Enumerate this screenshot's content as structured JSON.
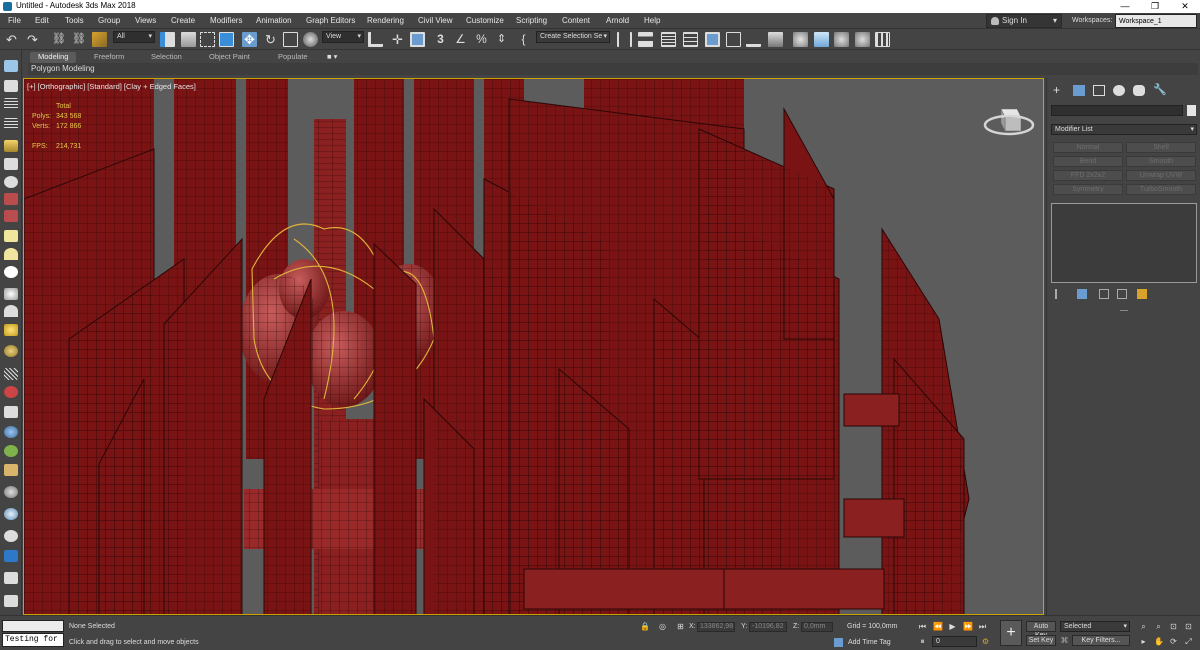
{
  "window": {
    "title": "Untitled - Autodesk 3ds Max 2018",
    "minimize_glyph": "—",
    "maximize_glyph": "❐",
    "close_glyph": "✕"
  },
  "menu": {
    "items": [
      "File",
      "Edit",
      "Tools",
      "Group",
      "Views",
      "Create",
      "Modifiers",
      "Animation",
      "Graph Editors",
      "Rendering",
      "Civil View",
      "Customize",
      "Scripting",
      "Content",
      "Arnold",
      "Help"
    ],
    "sign_in": "Sign In",
    "workspaces_label": "Workspaces:",
    "workspace_value": "Workspace_1"
  },
  "toolbar": {
    "selection_filter": "All",
    "reference_coord": "View",
    "named_selection": "Create Selection Se"
  },
  "ribbon": {
    "tabs": [
      "Modeling",
      "Freeform",
      "Selection",
      "Object Paint",
      "Populate"
    ],
    "active_tab": "Modeling",
    "sub_label": "Polygon Modeling"
  },
  "viewport": {
    "label": "[+] [Orthographic] [Standard] [Clay + Edged Faces]",
    "stats": {
      "total_label": "Total",
      "polys_label": "Polys:",
      "polys_value": "343 568",
      "verts_label": "Verts:",
      "verts_value": "172 866",
      "fps_label": "FPS:",
      "fps_value": "214,731"
    },
    "model_color": "#7a1414",
    "background_color": "#5c5c5c",
    "spline_color": "#e0b43a"
  },
  "command_panel": {
    "modifier_list": "Modifier List",
    "modifier_buttons": [
      "Normal",
      "Shell",
      "Bend",
      "Smooth",
      "FFD 2x2x2",
      "Unwrap UVW",
      "Symmetry",
      "TurboSmooth"
    ]
  },
  "status": {
    "selection_status": "None Selected",
    "prompt": "Click and drag to select and move objects",
    "maxscript_input": "Testing for :",
    "x_label": "X:",
    "x_value": "133862,98",
    "y_label": "Y:",
    "y_value": "-10196,82",
    "z_label": "Z:",
    "z_value": "0,0mm",
    "grid": "Grid = 100,0mm",
    "add_time_tag": "Add Time Tag",
    "auto_key": "Auto Key",
    "set_key": "Set Key",
    "key_mode": "Selected",
    "key_filters": "Key Filters...",
    "frame": "0"
  }
}
